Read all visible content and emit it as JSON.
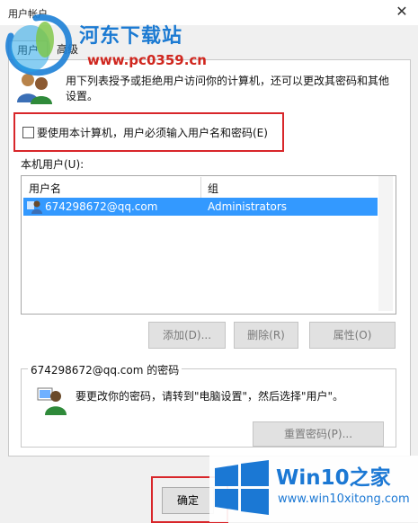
{
  "window": {
    "title": "用户帐户",
    "close_glyph": "✕"
  },
  "tabs": [
    {
      "label": "用户",
      "selected": true
    },
    {
      "label": "高级",
      "selected": false
    }
  ],
  "description": "用下列表授予或拒绝用户访问你的计算机，还可以更改其密码和其他设置。",
  "require_login": {
    "label": "要使用本计算机，用户必须输入用户名和密码(E)",
    "checked": false
  },
  "users_list": {
    "label": "本机用户(U):",
    "columns": [
      "用户名",
      "组"
    ],
    "rows": [
      {
        "username": "674298672@qq.com",
        "group": "Administrators",
        "selected": true
      }
    ]
  },
  "list_buttons": {
    "add": "添加(D)...",
    "remove": "删除(R)",
    "properties": "属性(O)"
  },
  "password_group": {
    "legend": "674298672@qq.com 的密码",
    "text": "要更改你的密码，请转到\"电脑设置\"，然后选择\"用户\"。",
    "reset_button": "重置密码(P)..."
  },
  "footer": {
    "ok_label": "确定"
  },
  "watermarks": {
    "top_brand": "河东下载站",
    "top_url": "www.pc0359.cn",
    "bottom_brand": "Win10之家",
    "bottom_url": "www.win10xitong.com"
  },
  "colors": {
    "selection": "#3399ff",
    "highlight_box": "#d8262a",
    "win10_blue": "#1b78d4"
  }
}
